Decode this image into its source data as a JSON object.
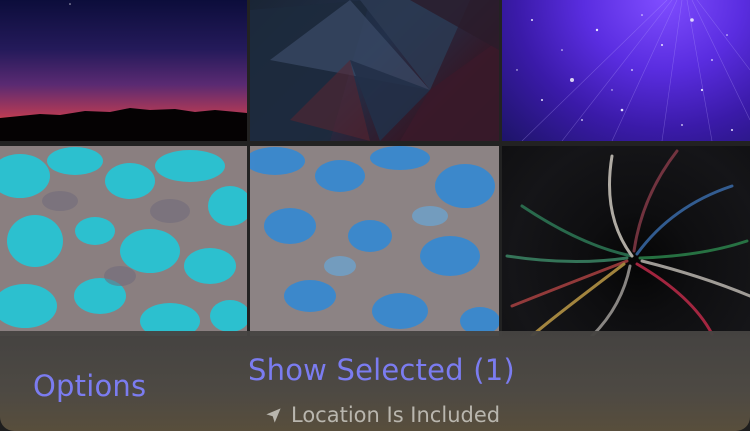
{
  "photos": [
    {
      "icon": "sunset-photo"
    },
    {
      "icon": "geometric-wallpaper"
    },
    {
      "icon": "purple-starfield"
    },
    {
      "icon": "cyan-blob-pattern"
    },
    {
      "icon": "blue-blob-pattern"
    },
    {
      "icon": "dark-color-swirl"
    }
  ],
  "toolbar": {
    "options_label": "Options",
    "show_selected_label": "Show Selected (1)",
    "location_label": "Location Is Included",
    "location_icon": "location-arrow-icon"
  },
  "colors": {
    "accent": "#7b7cf0",
    "secondary_text": "#b9b6ae"
  }
}
